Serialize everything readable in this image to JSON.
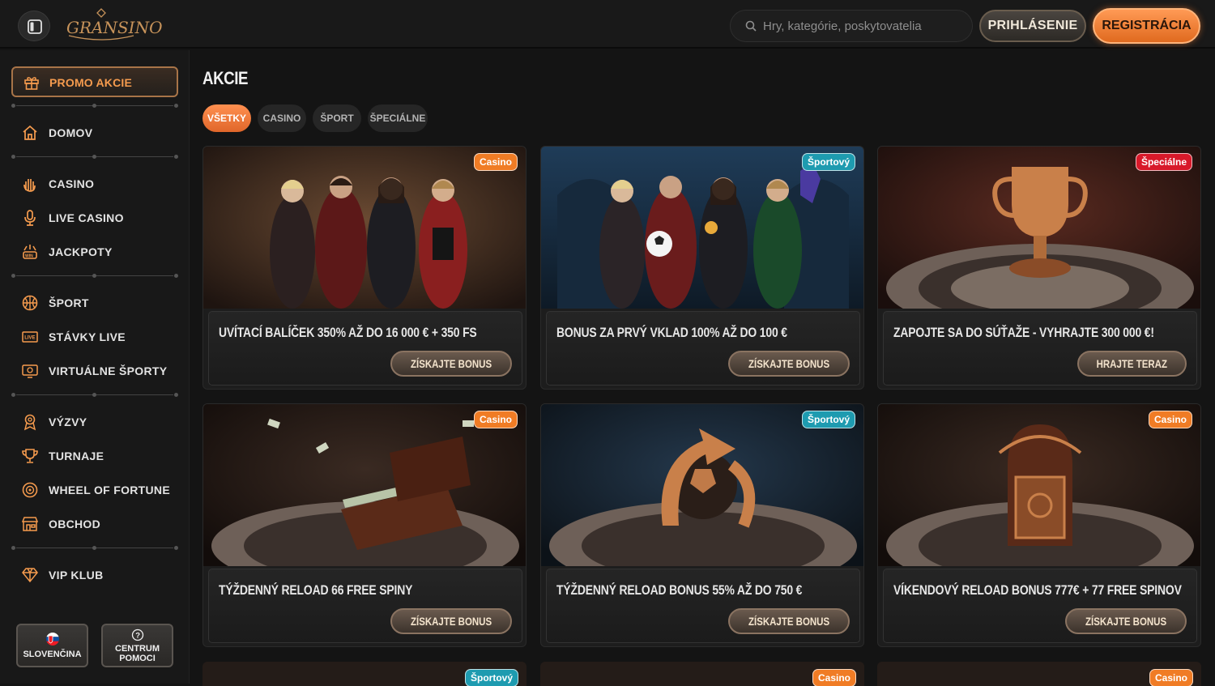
{
  "header": {
    "logo": "GRANSINO",
    "search_placeholder": "Hry, kategórie, poskytovatelia",
    "login": "PRIHLÁSENIE",
    "register": "REGISTRÁCIA"
  },
  "sidebar": {
    "promo": "PROMO AKCIE",
    "items": [
      {
        "label": "DOMOV",
        "icon": "home-icon"
      },
      {
        "label": "CASINO",
        "icon": "casino-hand-icon"
      },
      {
        "label": "LIVE CASINO",
        "icon": "microphone-icon"
      },
      {
        "label": "JACKPOTY",
        "icon": "jackpot-win-icon"
      },
      {
        "label": "ŠPORT",
        "icon": "basketball-icon"
      },
      {
        "label": "STÁVKY LIVE",
        "icon": "live-badge-icon"
      },
      {
        "label": "VIRTUÁLNE ŠPORTY",
        "icon": "virtual-monitor-icon"
      },
      {
        "label": "VÝZVY",
        "icon": "challenge-medal-icon"
      },
      {
        "label": "TURNAJE",
        "icon": "trophy-icon"
      },
      {
        "label": "WHEEL OF FORTUNE",
        "icon": "wheel-icon"
      },
      {
        "label": "OBCHOD",
        "icon": "shop-icon"
      },
      {
        "label": "VIP KLUB",
        "icon": "diamond-icon"
      }
    ],
    "language": "SLOVENČINA",
    "help": [
      "CENTRUM",
      "POMOCI"
    ]
  },
  "main": {
    "title": "AKCIE",
    "tabs": [
      "VŠETKY",
      "CASINO",
      "ŠPORT",
      "ŠPECIÁLNE"
    ],
    "cards": [
      {
        "badge": "Casino",
        "title": "UVÍTACÍ BALÍČEK 350% AŽ DO 16 000 € + 350 FS",
        "button": "ZÍSKAJTE BONUS"
      },
      {
        "badge": "Športový",
        "title": "BONUS ZA PRVÝ VKLAD 100% AŽ DO 100 €",
        "button": "ZÍSKAJTE BONUS"
      },
      {
        "badge": "Špeciálne",
        "title": "ZAPOJTE SA DO SÚŤAŽE - VYHRAJTE 300 000 €!",
        "button": "HRAJTE TERAZ"
      },
      {
        "badge": "Casino",
        "title": "TÝŽDENNÝ RELOAD 66 FREE SPINY",
        "button": "ZÍSKAJTE BONUS"
      },
      {
        "badge": "Športový",
        "title": "TÝŽDENNÝ RELOAD BONUS 55% AŽ DO 750 €",
        "button": "ZÍSKAJTE BONUS"
      },
      {
        "badge": "Casino",
        "title": "VÍKENDOVÝ RELOAD BONUS 777€ + 77 FREE SPINOV",
        "button": "ZÍSKAJTE BONUS"
      }
    ],
    "partial_badges": [
      "Športový",
      "Casino",
      "Casino"
    ]
  },
  "colors": {
    "accent": "#f07c25",
    "sport": "#1e9bb0",
    "special": "#d8192a"
  }
}
